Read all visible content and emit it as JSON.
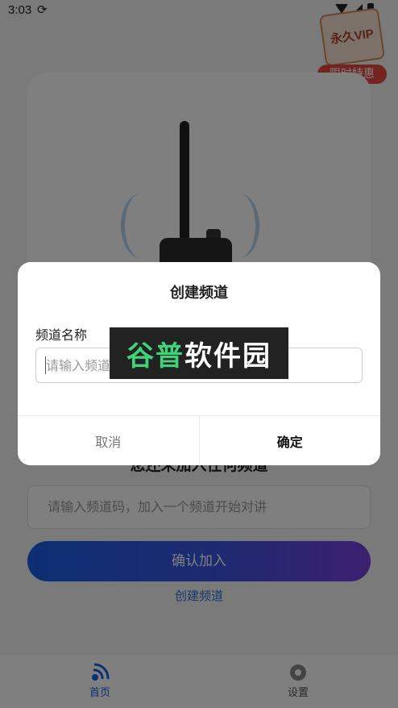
{
  "status_bar": {
    "time": "3:03"
  },
  "vip_badge": {
    "title": "永久VIP",
    "promo": "限时特惠"
  },
  "main": {
    "join_title": "您还未加入任何频道",
    "code_placeholder": "请输入频道码，加入一个频道开始对讲",
    "confirm_join_label": "确认加入",
    "create_channel_link": "创建频道"
  },
  "tabbar": {
    "home_label": "首页",
    "settings_label": "设置"
  },
  "dialog": {
    "title": "创建频道",
    "field_label": "频道名称",
    "input_placeholder": "请输入频道名称",
    "cancel_label": "取消",
    "ok_label": "确定"
  },
  "watermark": {
    "part1": "谷普",
    "part2": "软件园"
  },
  "colors": {
    "accent": "#1a5ee8",
    "gradient_end": "#7a3fe0",
    "link": "#2e6fd8",
    "promo_red": "#e8483c",
    "watermark_green": "#3ed47c"
  }
}
